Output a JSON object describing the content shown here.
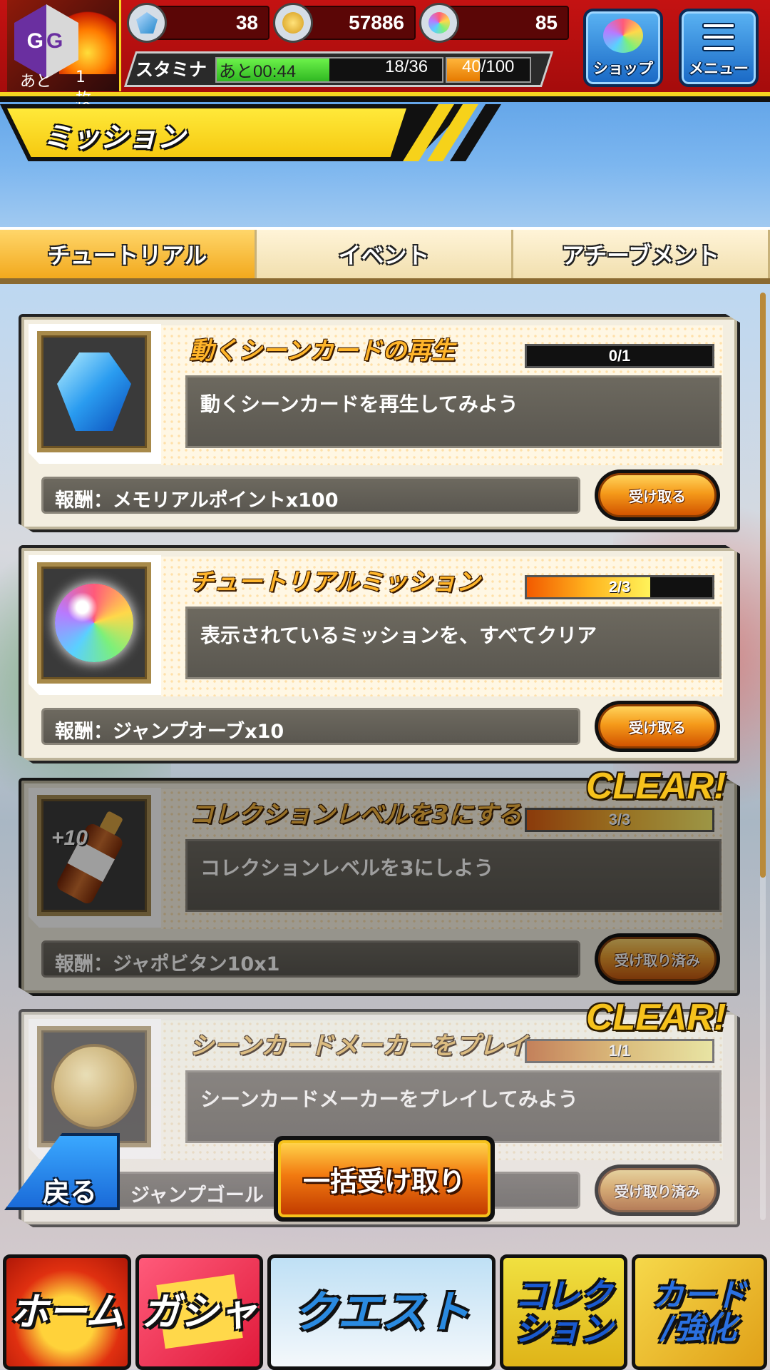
{
  "header": {
    "tickets_prefix": "あと",
    "tickets_value": "1枚",
    "gems": "38",
    "coins": "57886",
    "orbs": "85",
    "stamina_label": "スタミナ",
    "stamina_timer": "あと00:44",
    "stamina_count": "18/36",
    "stamina_fraction": 0.5,
    "exp_count": "40/100",
    "exp_fraction": 0.4,
    "shop_label": "ショップ",
    "menu_label": "メニュー"
  },
  "page_title": "ミッション",
  "tabs": [
    {
      "label": "チュートリアル",
      "active": true
    },
    {
      "label": "イベント",
      "active": false
    },
    {
      "label": "アチーブメント",
      "active": false
    }
  ],
  "missions": [
    {
      "icon": "blue-gem-icon",
      "title": "動くシーンカードの再生",
      "progress": "0/1",
      "progress_fraction": 0,
      "description": "動くシーンカードを再生してみよう",
      "reward": "報酬：メモリアルポイントx100",
      "button": "受け取る",
      "clear": ""
    },
    {
      "icon": "rainbow-orb-icon",
      "title": "チュートリアルミッション",
      "progress": "2/3",
      "progress_fraction": 0.667,
      "description": "表示されているミッションを、すべてクリア",
      "reward": "報酬：ジャンプオーブx10",
      "button": "受け取る",
      "clear": ""
    },
    {
      "icon": "japobitan-bottle-icon",
      "title": "コレクションレベルを3にする",
      "progress": "3/3",
      "progress_fraction": 1,
      "description": "コレクションレベルを3にしよう",
      "reward": "報酬：ジャポビタン10x1",
      "button": "受け取り済み",
      "clear": "CLEAR!",
      "icon_badge": "+10"
    },
    {
      "icon": "jump-gold-coin-icon",
      "title": "シーンカードメーカーをプレイ",
      "progress": "1/1",
      "progress_fraction": 1,
      "description": "シーンカードメーカーをプレイしてみよう",
      "reward": "ジャンプゴール",
      "button": "受け取り済み",
      "clear": "CLEAR!"
    }
  ],
  "back_label": "戻る",
  "bulk_claim_label": "一括受け取り",
  "nav": {
    "home": "ホーム",
    "gacha": "ガシャ",
    "quest": "クエスト",
    "collection_1": "コレク",
    "collection_2": "ション",
    "card_1": "カード",
    "card_2": "/強化"
  },
  "colors": {
    "header_red": "#c41212",
    "accent_yellow": "#f5d420",
    "tab_active": "#f2a91d",
    "button_blue": "#1968c5"
  }
}
